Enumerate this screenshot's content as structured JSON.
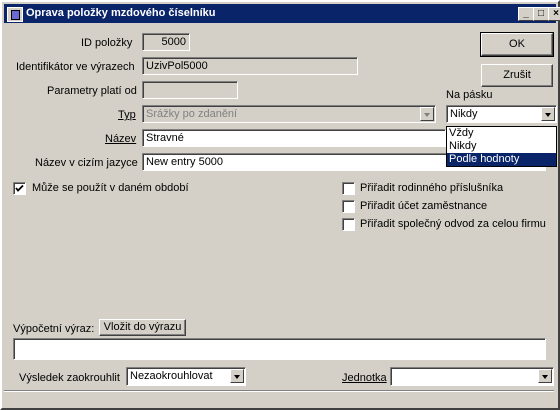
{
  "window": {
    "title": "Oprava položky mzdového číselníku",
    "minimize": "_",
    "maximize": "□",
    "close": "×"
  },
  "fields": {
    "id_label": "ID položky",
    "id_value": "5000",
    "ident_label": "Identifikátor ve výrazech",
    "ident_value": "UzivPol5000",
    "params_label": "Parametry platí od",
    "params_value": "",
    "typ_label": "Typ",
    "typ_value": "Srážky po zdanění",
    "nazev_label": "Název",
    "nazev_value": "Stravné",
    "nazev_cizi_label": "Název v cizím jazyce",
    "nazev_cizi_value": "New entry 5000"
  },
  "buttons": {
    "ok": "OK",
    "zrusit": "Zrušit",
    "vlozit": "Vložit do výrazu"
  },
  "na_pasku": {
    "label": "Na pásku",
    "value": "Nikdy",
    "options": [
      "Vždy",
      "Nikdy",
      "Podle hodnoty"
    ]
  },
  "checkboxes": {
    "muze": "Může se použít v daném období",
    "muze_checked": true,
    "rodinny": "Přiřadit rodinného příslušníka",
    "ucet": "Přiřadit účet zaměstnance",
    "odvod": "Přiřadit společný odvod za celou firmu"
  },
  "vypocet": {
    "label": "Výpočetní výraz:",
    "value": ""
  },
  "zaokrouhleni": {
    "label": "Výsledek zaokrouhlit",
    "value": "Nezaokrouhlovat"
  },
  "jednotka": {
    "label": "Jednotka",
    "value": ""
  }
}
